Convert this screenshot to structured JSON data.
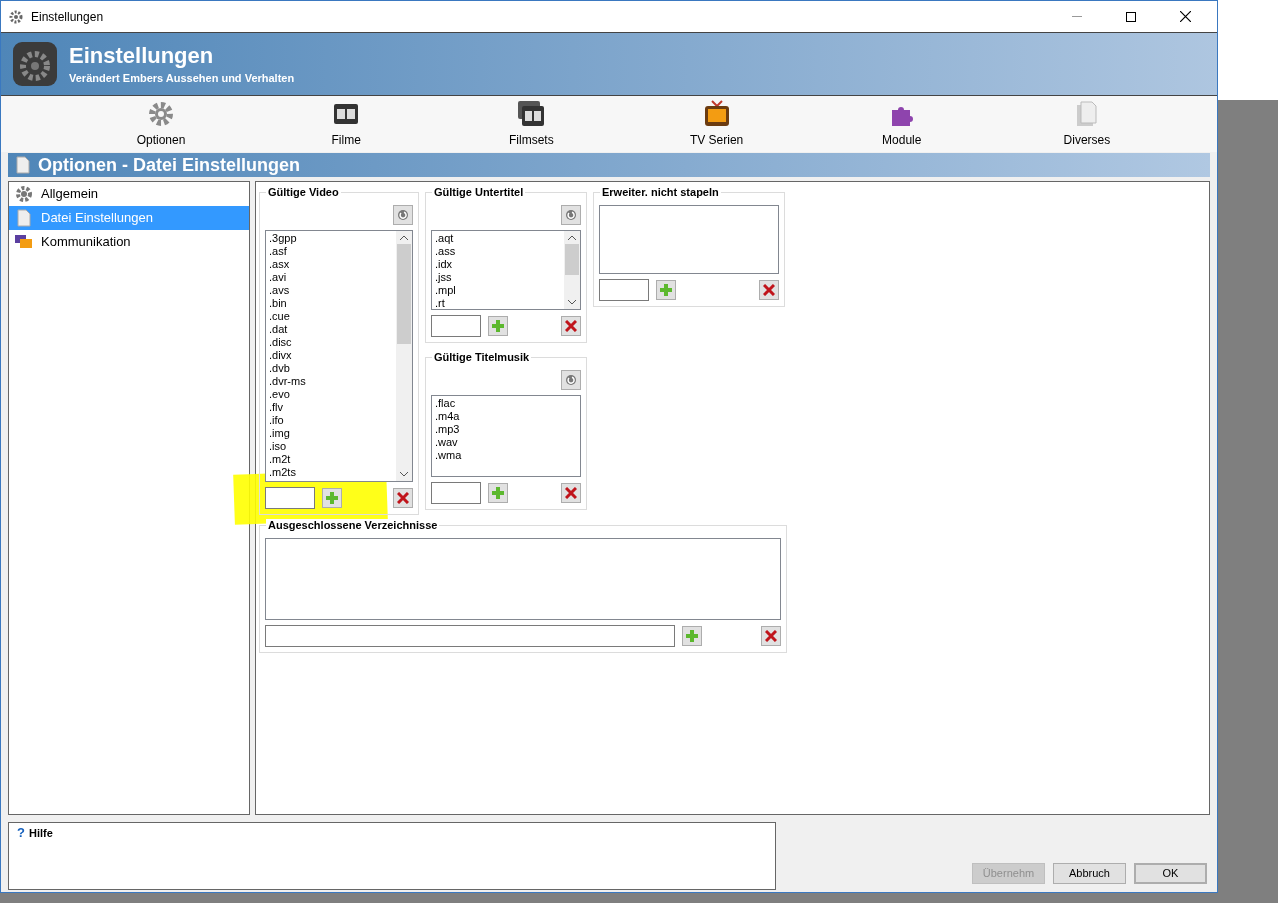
{
  "window": {
    "title": "Einstellungen"
  },
  "header": {
    "title": "Einstellungen",
    "subtitle": "Verändert Embers Aussehen und Verhalten"
  },
  "toolbar": [
    {
      "label": "Optionen",
      "kind": "gear"
    },
    {
      "label": "Filme",
      "kind": "film"
    },
    {
      "label": "Filmsets",
      "kind": "films"
    },
    {
      "label": "TV Serien",
      "kind": "tv"
    },
    {
      "label": "Module",
      "kind": "puzzle"
    },
    {
      "label": "Diverses",
      "kind": "pages"
    }
  ],
  "section_title": "Optionen - Datei Einstellungen",
  "sidebar": [
    {
      "label": "Allgemein",
      "selected": false,
      "kind": "gear"
    },
    {
      "label": "Datei Einstellungen",
      "selected": true,
      "kind": "page"
    },
    {
      "label": "Kommunikation",
      "selected": false,
      "kind": "chat"
    }
  ],
  "groups": [
    {
      "title": "Gültige Video",
      "reset_button": true,
      "scrollbar": true,
      "items": [
        ".3gpp",
        ".asf",
        ".asx",
        ".avi",
        ".avs",
        ".bin",
        ".cue",
        ".dat",
        ".disc",
        ".divx",
        ".dvb",
        ".dvr-ms",
        ".evo",
        ".flv",
        ".ifo",
        ".img",
        ".iso",
        ".m2t",
        ".m2ts"
      ]
    },
    {
      "title": "Gültige Untertitel",
      "reset_button": true,
      "scrollbar": true,
      "items": [
        ".aqt",
        ".ass",
        ".idx",
        ".jss",
        ".mpl",
        ".rt"
      ]
    },
    {
      "title": "Gültige Titelmusik",
      "reset_button": true,
      "scrollbar": false,
      "items": [
        ".flac",
        ".m4a",
        ".mp3",
        ".wav",
        ".wma"
      ]
    },
    {
      "title": "Erweiter. nicht stapeln",
      "reset_button": false,
      "scrollbar": false
    },
    {
      "title": "Ausgeschlossene Verzeichnisse",
      "reset_button": false,
      "scrollbar": false
    }
  ],
  "help": {
    "icon": "?",
    "title": "Hilfe"
  },
  "buttons": [
    {
      "label": "Übernehm",
      "disabled": true,
      "default": false
    },
    {
      "label": "Abbruch",
      "disabled": false,
      "default": false
    },
    {
      "label": "OK",
      "disabled": false,
      "default": true
    }
  ]
}
